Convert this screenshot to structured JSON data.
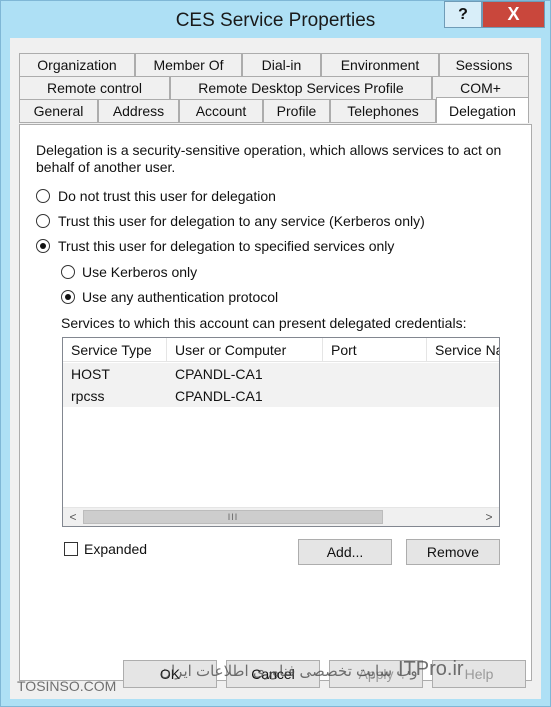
{
  "window": {
    "title": "CES Service Properties",
    "help_glyph": "?",
    "close_glyph": "X"
  },
  "tabs": {
    "row1": [
      "Organization",
      "Member Of",
      "Dial-in",
      "Environment",
      "Sessions"
    ],
    "row2": [
      "Remote control",
      "Remote Desktop Services Profile",
      "COM+"
    ],
    "row3": [
      "General",
      "Address",
      "Account",
      "Profile",
      "Telephones",
      "Delegation"
    ]
  },
  "delegation": {
    "description_line1": "Delegation is a security-sensitive operation, which allows services to act on",
    "description_line2": "behalf of another user.",
    "options": [
      {
        "label": "Do not trust this user for delegation",
        "selected": false
      },
      {
        "label": "Trust this user for delegation to any service (Kerberos only)",
        "selected": false
      },
      {
        "label": "Trust this user for delegation to specified services only",
        "selected": true
      }
    ],
    "sub_options": [
      {
        "label": "Use Kerberos only",
        "selected": false
      },
      {
        "label": "Use any authentication protocol",
        "selected": true
      }
    ],
    "services_caption": "Services to which this account can present delegated credentials:",
    "columns": [
      "Service Type",
      "User or Computer",
      "Port",
      "Service Na"
    ],
    "rows": [
      {
        "service_type": "HOST",
        "user_or_computer": "CPANDL-CA1",
        "port": "",
        "service_name": ""
      },
      {
        "service_type": "rpcss",
        "user_or_computer": "CPANDL-CA1",
        "port": "",
        "service_name": ""
      }
    ],
    "scroll": {
      "left": "<",
      "right": ">",
      "grip": "III"
    },
    "expanded_label": "Expanded",
    "expanded_checked": false,
    "add_label": "Add...",
    "remove_label": "Remove"
  },
  "footer": {
    "ok": "OK",
    "cancel": "Cancel",
    "apply": "Apply",
    "help": "Help"
  },
  "watermark": {
    "left": "TOSINSO.COM",
    "right": "ITPro.ir",
    "middle": "وب سایت تخصصی فناوری اطلاعات ایران"
  }
}
